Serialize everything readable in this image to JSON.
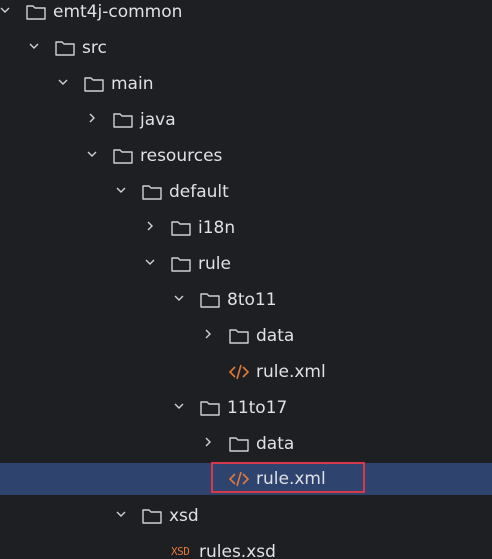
{
  "project_tree": {
    "items": [
      {
        "label": "emt4j-common",
        "type": "folder",
        "state": "expanded"
      },
      {
        "label": "src",
        "type": "folder",
        "state": "expanded"
      },
      {
        "label": "main",
        "type": "folder",
        "state": "expanded"
      },
      {
        "label": "java",
        "type": "folder",
        "state": "collapsed"
      },
      {
        "label": "resources",
        "type": "folder",
        "state": "expanded"
      },
      {
        "label": "default",
        "type": "folder",
        "state": "expanded"
      },
      {
        "label": "i18n",
        "type": "folder",
        "state": "collapsed"
      },
      {
        "label": "rule",
        "type": "folder",
        "state": "expanded"
      },
      {
        "label": "8to11",
        "type": "folder",
        "state": "expanded"
      },
      {
        "label": "data",
        "type": "folder",
        "state": "collapsed"
      },
      {
        "label": "rule.xml",
        "type": "xml-file",
        "state": "leaf"
      },
      {
        "label": "11to17",
        "type": "folder",
        "state": "expanded"
      },
      {
        "label": "data",
        "type": "folder",
        "state": "collapsed"
      },
      {
        "label": "rule.xml",
        "type": "xml-file",
        "state": "leaf",
        "selected": true
      },
      {
        "label": "xsd",
        "type": "folder",
        "state": "expanded"
      },
      {
        "label": "rules.xsd",
        "type": "xsd-file",
        "state": "leaf"
      }
    ],
    "xsd_badge": "XSD"
  },
  "colors": {
    "background": "#1e1f22",
    "selection": "#2e436e",
    "text": "#dfe1e5",
    "icon": "#cfd1d6",
    "xml_icon": "#e07a3a",
    "highlight_border": "#d63a4a"
  }
}
